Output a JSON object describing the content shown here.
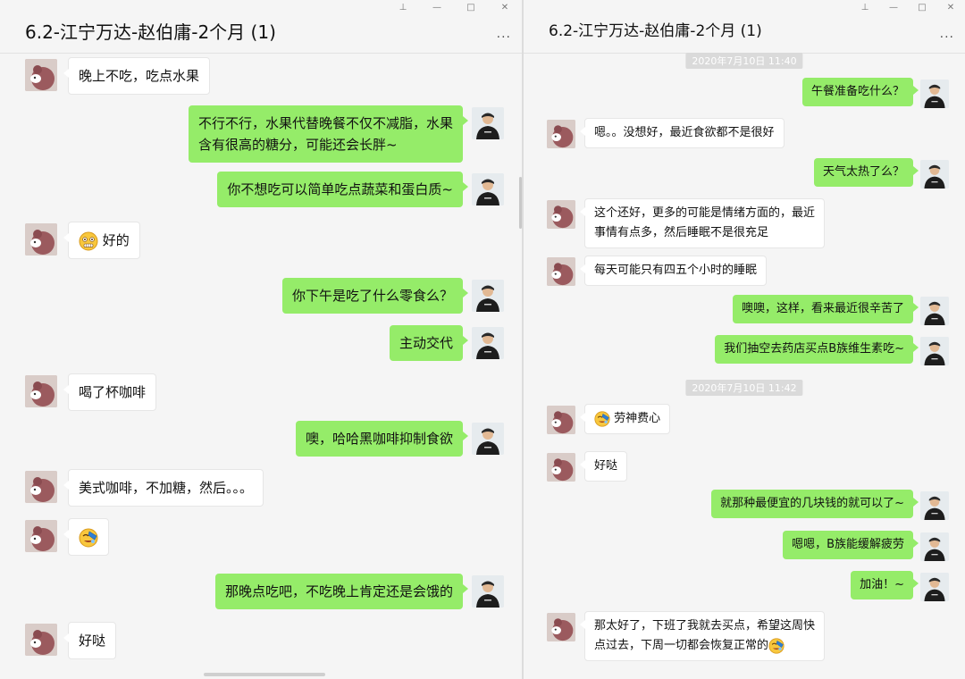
{
  "left": {
    "title": "6.2-江宁万达-赵伯庸-2个月 (1)",
    "more_label": "...",
    "window_controls": [
      "⊥",
      "—",
      "□",
      "✕"
    ],
    "messages": [
      {
        "side": "in",
        "lines": [
          "晚上不吃，吃点水果"
        ]
      },
      {
        "side": "out",
        "lines": [
          "不行不行，水果代替晚餐不仅不减脂，水果",
          "含有很高的糖分，可能还会长胖~"
        ]
      },
      {
        "side": "out",
        "lines": [
          "你不想吃可以简单吃点蔬菜和蛋白质~"
        ]
      },
      {
        "side": "in",
        "emoji": "grimace-emoji",
        "lines": [
          "好的"
        ]
      },
      {
        "side": "out",
        "lines": [
          "你下午是吃了什么零食么？"
        ]
      },
      {
        "side": "out",
        "lines": [
          "主动交代"
        ]
      },
      {
        "side": "in",
        "lines": [
          "喝了杯咖啡"
        ]
      },
      {
        "side": "out",
        "lines": [
          "噢，哈哈黑咖啡抑制食欲"
        ]
      },
      {
        "side": "in",
        "lines": [
          "美式咖啡，不加糖，然后。。。"
        ]
      },
      {
        "side": "in",
        "emoji": "facepalm-emoji",
        "lines": [
          ""
        ]
      },
      {
        "side": "out",
        "lines": [
          "那晚点吃吧，不吃晚上肯定还是会饿的"
        ]
      },
      {
        "side": "in",
        "lines": [
          "好哒"
        ]
      }
    ]
  },
  "right": {
    "title": "6.2-江宁万达-赵伯庸-2个月 (1)",
    "more_label": "...",
    "window_controls": [
      "⊥",
      "—",
      "□",
      "✕"
    ],
    "timestamps": [
      "2020年7月10日 11:40",
      "2020年7月10日 11:42"
    ],
    "messages": [
      {
        "side": "out",
        "lines": [
          "午餐准备吃什么？"
        ]
      },
      {
        "side": "in",
        "lines": [
          "嗯。。没想好，最近食欲都不是很好"
        ]
      },
      {
        "side": "out",
        "lines": [
          "天气太热了么？"
        ]
      },
      {
        "side": "in",
        "lines": [
          "这个还好，更多的可能是情绪方面的，最近",
          "事情有点多，然后睡眠不是很充足"
        ]
      },
      {
        "side": "in",
        "lines": [
          "每天可能只有四五个小时的睡眠"
        ]
      },
      {
        "side": "out",
        "lines": [
          "噢噢，这样，看来最近很辛苦了"
        ]
      },
      {
        "side": "out",
        "lines": [
          "我们抽空去药店买点B族维生素吃~"
        ]
      },
      {
        "side": "in",
        "emoji": "facepalm-emoji",
        "lines": [
          "劳神费心"
        ]
      },
      {
        "side": "in",
        "lines": [
          "好哒"
        ]
      },
      {
        "side": "out",
        "lines": [
          "就那种最便宜的几块钱的就可以了~"
        ]
      },
      {
        "side": "out",
        "lines": [
          "嗯嗯，B族能缓解疲劳"
        ]
      },
      {
        "side": "out",
        "lines": [
          "加油！~"
        ]
      },
      {
        "side": "in",
        "lines": [
          "那太好了，下班了我就去买点，希望这周快",
          "点过去，下周一切都会恢复正常的"
        ],
        "trailing_emoji": "facepalm-emoji"
      }
    ]
  }
}
